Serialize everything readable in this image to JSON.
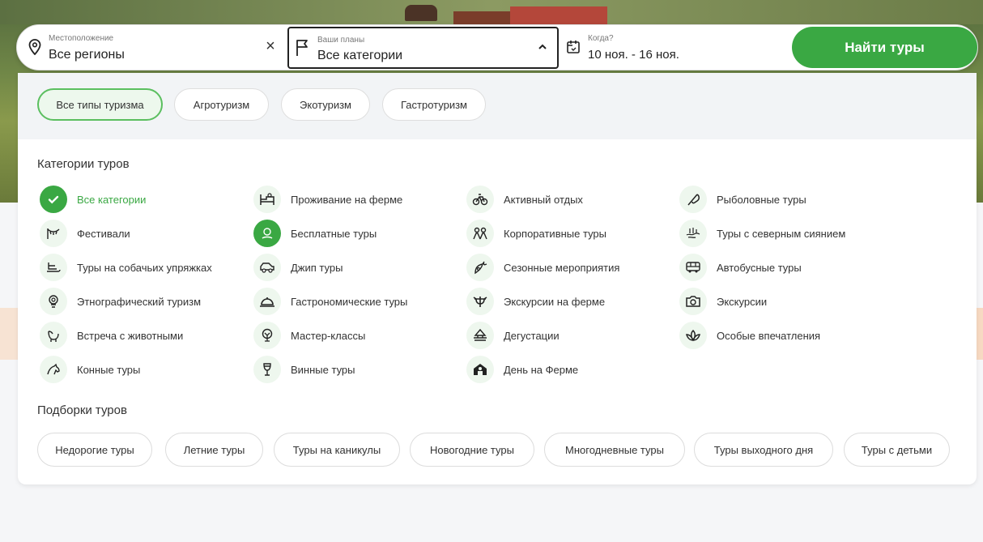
{
  "search": {
    "location_label": "Местоположение",
    "location_value": "Все регионы",
    "clear_glyph": "×",
    "plans_label": "Ваши планы",
    "plans_value": "Все категории",
    "when_label": "Когда?",
    "when_value": "10 ноя. - 16 ноя.",
    "submit_label": "Найти туры"
  },
  "tourism_types": [
    {
      "label": "Все типы туризма",
      "active": true
    },
    {
      "label": "Агротуризм",
      "active": false
    },
    {
      "label": "Экотуризм",
      "active": false
    },
    {
      "label": "Гастротуризм",
      "active": false
    }
  ],
  "categories_title": "Категории туров",
  "categories": [
    {
      "label": "Все категории",
      "icon": "check-icon",
      "selected": true
    },
    {
      "label": "Проживание на ферме",
      "icon": "bed-icon"
    },
    {
      "label": "Активный отдых",
      "icon": "bicycle-icon"
    },
    {
      "label": "Рыболовные туры",
      "icon": "fishing-icon"
    },
    {
      "label": "Фестивали",
      "icon": "garland-icon"
    },
    {
      "label": "Бесплатные туры",
      "icon": "free-tour-icon",
      "highlight": true
    },
    {
      "label": "Корпоративные туры",
      "icon": "group-icon"
    },
    {
      "label": "Туры с северным сиянием",
      "icon": "aurora-icon"
    },
    {
      "label": "Туры на собачьих упряжках",
      "icon": "sled-icon"
    },
    {
      "label": "Джип туры",
      "icon": "jeep-icon"
    },
    {
      "label": "Сезонные мероприятия",
      "icon": "seasonal-icon"
    },
    {
      "label": "Автобусные туры",
      "icon": "bus-icon"
    },
    {
      "label": "Этнографический туризм",
      "icon": "ethno-icon"
    },
    {
      "label": "Гастрономические туры",
      "icon": "cloche-icon"
    },
    {
      "label": "Экскурсии на ферме",
      "icon": "farm-excursion-icon"
    },
    {
      "label": "Экскурсии",
      "icon": "camera-icon"
    },
    {
      "label": "Встреча с животными",
      "icon": "animal-icon"
    },
    {
      "label": "Мастер-классы",
      "icon": "masterclass-icon"
    },
    {
      "label": "Дегустации",
      "icon": "tasting-icon"
    },
    {
      "label": "Особые впечатления",
      "icon": "lotus-icon"
    },
    {
      "label": "Конные туры",
      "icon": "horse-icon"
    },
    {
      "label": "Винные туры",
      "icon": "wine-glass-icon"
    },
    {
      "label": "День на Ферме",
      "icon": "farmhouse-icon"
    }
  ],
  "collections_title": "Подборки туров",
  "collections": [
    "Недорогие туры",
    "Летние туры",
    "Туры на каникулы",
    "Новогодние туры",
    "Многодневные туры",
    "Туры выходного дня",
    "Туры с детьми"
  ],
  "colors": {
    "accent": "#3aa843",
    "accent_light": "#eef7ee"
  }
}
